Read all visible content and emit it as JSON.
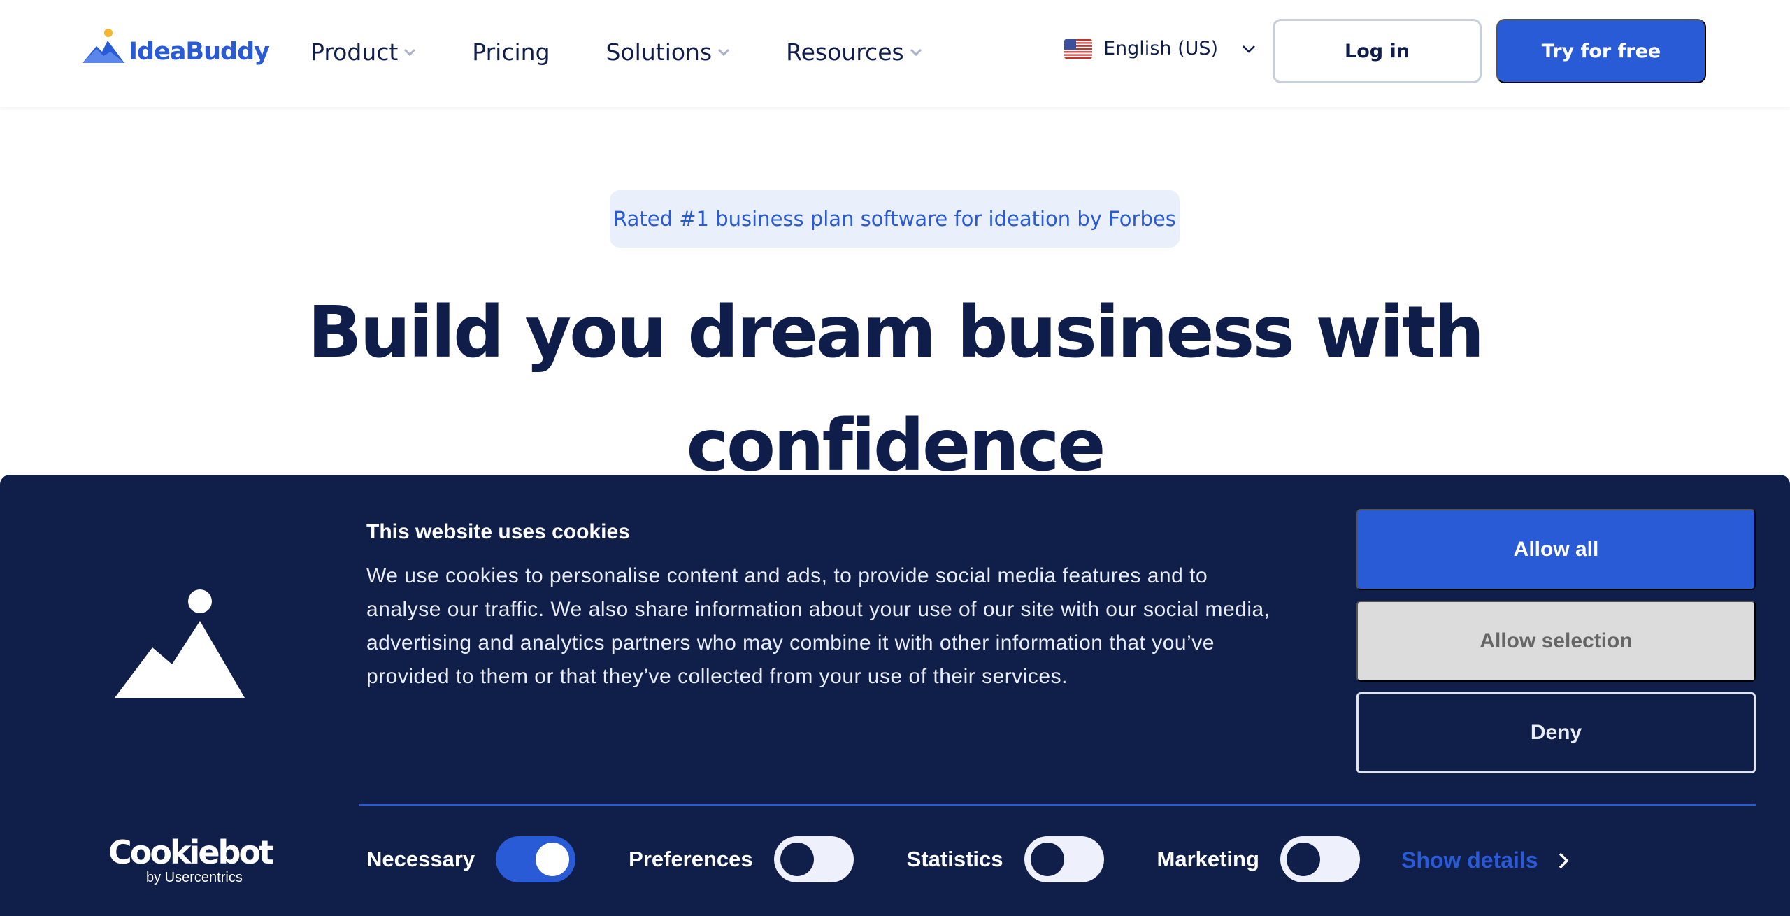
{
  "header": {
    "logo_text": "IdeaBuddy",
    "nav": [
      {
        "label": "Product",
        "has_dropdown": true
      },
      {
        "label": "Pricing",
        "has_dropdown": false
      },
      {
        "label": "Solutions",
        "has_dropdown": true
      },
      {
        "label": "Resources",
        "has_dropdown": true
      }
    ],
    "language": {
      "label": "English (US)",
      "flag_icon": "us-flag-icon"
    },
    "login_label": "Log in",
    "try_label": "Try for free"
  },
  "hero": {
    "badge": "Rated #1 business plan software for ideation by Forbes",
    "title": "Build you dream business with confidence"
  },
  "cookie_banner": {
    "title": "This website uses cookies",
    "body": "We use cookies to personalise content and ads, to provide social media features and to analyse our traffic. We also share information about your use of our site with our social media, advertising and analytics partners who may combine it with other information that you’ve provided to them or that they’ve collected from your use of their services.",
    "buttons": {
      "allow_all": "Allow all",
      "allow_selection": "Allow selection",
      "deny": "Deny"
    },
    "toggles": [
      {
        "label": "Necessary",
        "on": true
      },
      {
        "label": "Preferences",
        "on": false
      },
      {
        "label": "Statistics",
        "on": false
      },
      {
        "label": "Marketing",
        "on": false
      }
    ],
    "show_details": "Show details",
    "brand": {
      "name": "Cookiebot",
      "sub": "by Usercentrics"
    }
  },
  "colors": {
    "brand_blue": "#2a5bd7",
    "navy": "#101e4a",
    "badge_bg": "#e9f0fc",
    "gray_button": "#dcdcdc"
  }
}
